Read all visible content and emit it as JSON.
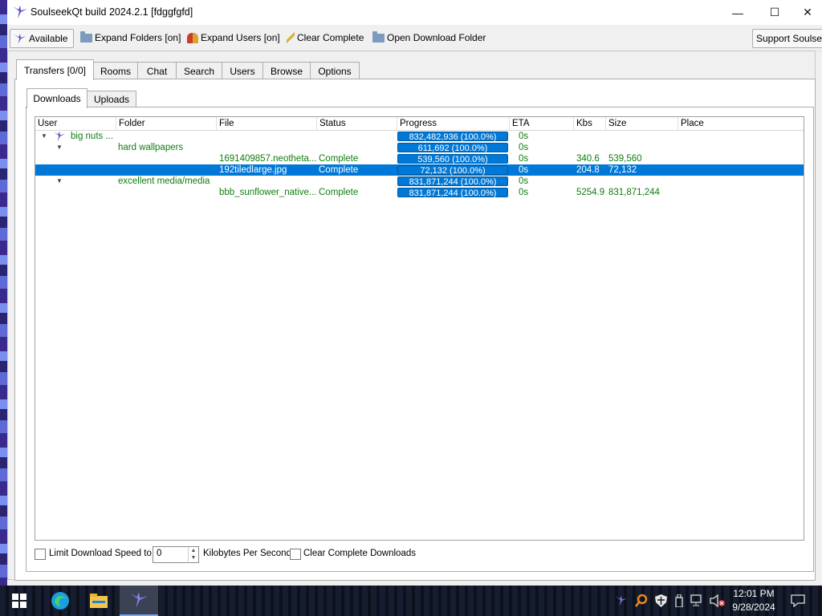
{
  "window": {
    "title": "SoulseekQt build 2024.2.1 [fdggfgfd]",
    "controls": {
      "minimize": "—",
      "maximize": "☐",
      "close": "✕"
    }
  },
  "toolbar": {
    "available": "Available",
    "expand_folders": "Expand Folders [on]",
    "expand_users": "Expand Users [on]",
    "clear_complete": "Clear Complete",
    "open_download_folder": "Open Download Folder",
    "support": "Support Soulseek"
  },
  "tabs": [
    "Transfers [0/0]",
    "Rooms",
    "Chat",
    "Search",
    "Users",
    "Browse",
    "Options"
  ],
  "subtabs": [
    "Downloads",
    "Uploads"
  ],
  "columns": [
    "User",
    "Folder",
    "File",
    "Status",
    "Progress",
    "ETA",
    "Kbs",
    "Size",
    "Place"
  ],
  "rows": [
    {
      "user": "big nuts ...",
      "folder": "",
      "file": "",
      "status": "",
      "progress": "832,482,936 (100.0%)",
      "eta": "0s",
      "kbs": "",
      "size": "",
      "place": ""
    },
    {
      "user": "",
      "folder": "hard wallpapers",
      "file": "",
      "status": "",
      "progress": "611,692 (100.0%)",
      "eta": "0s",
      "kbs": "",
      "size": "",
      "place": ""
    },
    {
      "user": "",
      "folder": "",
      "file": "1691409857.neotheta...",
      "status": "Complete",
      "progress": "539,560 (100.0%)",
      "eta": "0s",
      "kbs": "340.6",
      "size": "539,560",
      "place": ""
    },
    {
      "user": "",
      "folder": "",
      "file": "192tiledlarge.jpg",
      "status": "Complete",
      "progress": "72,132 (100.0%)",
      "eta": "0s",
      "kbs": "204.8",
      "size": "72,132",
      "place": ""
    },
    {
      "user": "",
      "folder": "excellent media/media",
      "file": "",
      "status": "",
      "progress": "831,871,244 (100.0%)",
      "eta": "0s",
      "kbs": "",
      "size": "",
      "place": ""
    },
    {
      "user": "",
      "folder": "",
      "file": "bbb_sunflower_native...",
      "status": "Complete",
      "progress": "831,871,244 (100.0%)",
      "eta": "0s",
      "kbs": "5254.9",
      "size": "831,871,244",
      "place": ""
    }
  ],
  "bottom": {
    "limit_label": "Limit Download Speed to",
    "limit_value": "0",
    "unit_label": "Kilobytes Per Second",
    "clear_label": "Clear Complete Downloads"
  },
  "taskbar": {
    "time": "12:01 PM",
    "date": "9/28/2024"
  },
  "colors": {
    "accent": "#0078d7",
    "tree_text": "#107c10"
  }
}
